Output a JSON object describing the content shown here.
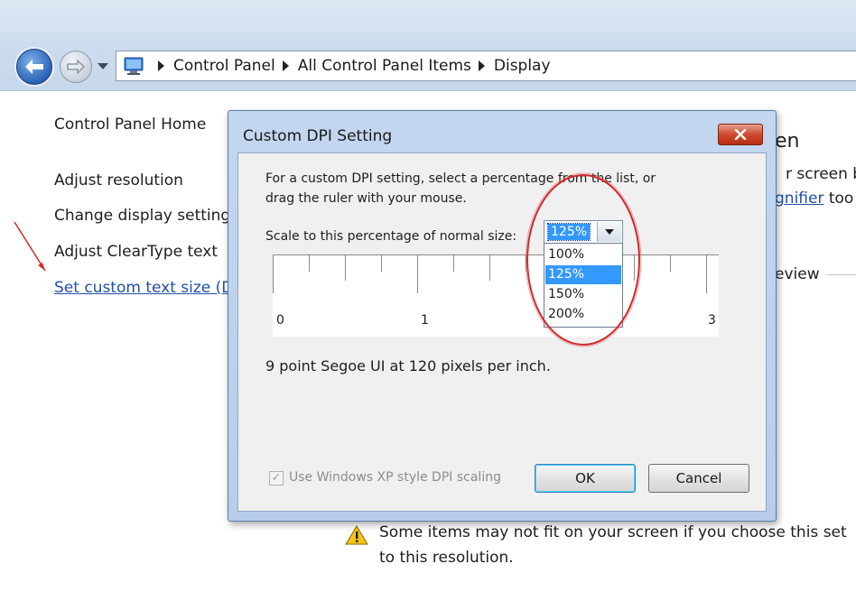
{
  "nav": {
    "breadcrumb": [
      "Control Panel",
      "All Control Panel Items",
      "Display"
    ],
    "back_icon": "back-arrow-icon",
    "forward_icon": "forward-arrow-icon"
  },
  "left_pane": {
    "home": "Control Panel Home",
    "links": [
      "Adjust resolution",
      "Change display setting",
      "Adjust ClearType text",
      "Set custom text size (D"
    ]
  },
  "main": {
    "heading_fragment": "en",
    "text_fragment": "r screen be",
    "link_fragment": "gnifier",
    "link_suffix": " too",
    "preview_fragment": "eview",
    "warning_line1": "Some items may not fit on your screen if you choose this set",
    "warning_line2": "to this resolution."
  },
  "dialog": {
    "title": "Custom DPI Setting",
    "close_glyph": "✕",
    "instructions_line1": "For a custom DPI setting, select a percentage from the list, or",
    "instructions_line2": "drag the ruler with your mouse.",
    "scale_label": "Scale to this percentage of normal size:",
    "selected_value": "125%",
    "options": [
      "100%",
      "125%",
      "150%",
      "200%"
    ],
    "selected_index": 1,
    "ruler_numbers": [
      "0",
      "1",
      "3"
    ],
    "dpi_info": "9 point Segoe UI at 120 pixels per inch.",
    "xp_scaling_label": "Use Windows XP style DPI scaling",
    "xp_scaling_checked": true,
    "ok_label": "OK",
    "cancel_label": "Cancel"
  },
  "colors": {
    "link": "#1f4fa8",
    "selection": "#3399ff",
    "annotation_red": "#d02a2a",
    "close_red": "#cf4a2f"
  }
}
